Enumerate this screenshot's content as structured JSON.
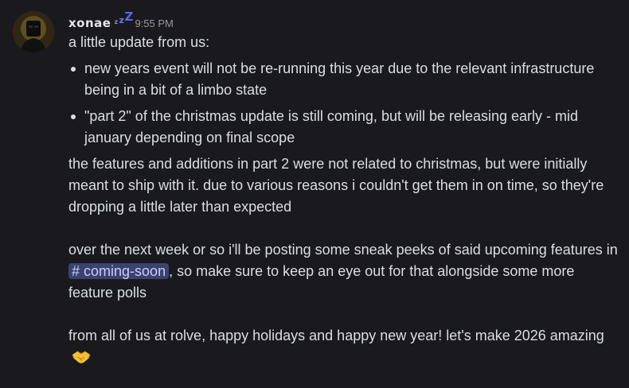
{
  "author": {
    "name_visible": "xonae",
    "name_fade": "",
    "timestamp": "9:55 PM",
    "status_icon": "zzz-idle-icon"
  },
  "message": {
    "intro": "a little update from us:",
    "bullets": [
      "new years event will not be re-running this year due to the relevant infrastructure being in a bit of a limbo state",
      "\"part 2\" of the christmas update is still coming, but will be releasing early - mid january depending on final scope"
    ],
    "paragraph1": "the features and additions in part 2 were not related to christmas, but were initially meant to ship with it. due to various reasons i couldn't get them in on time, so they're dropping a little later than expected",
    "paragraph2_before": "over the next week or so i'll be posting some sneak peeks of said upcoming features in ",
    "channel_mention": "coming-soon",
    "paragraph2_after": ", so make sure to keep an eye out for that alongside some more feature polls",
    "paragraph3": "from all of us at rolve, happy holidays and happy new year! let's make 2026 amazing",
    "emoji": "handshake-emoji"
  },
  "colors": {
    "background": "#1a1a1e",
    "text": "#dbdee1",
    "timestamp": "#949ba4",
    "mention_bg": "#3c4270",
    "mention_text": "#c9cdfb",
    "idle_accent": "#5865f2"
  }
}
